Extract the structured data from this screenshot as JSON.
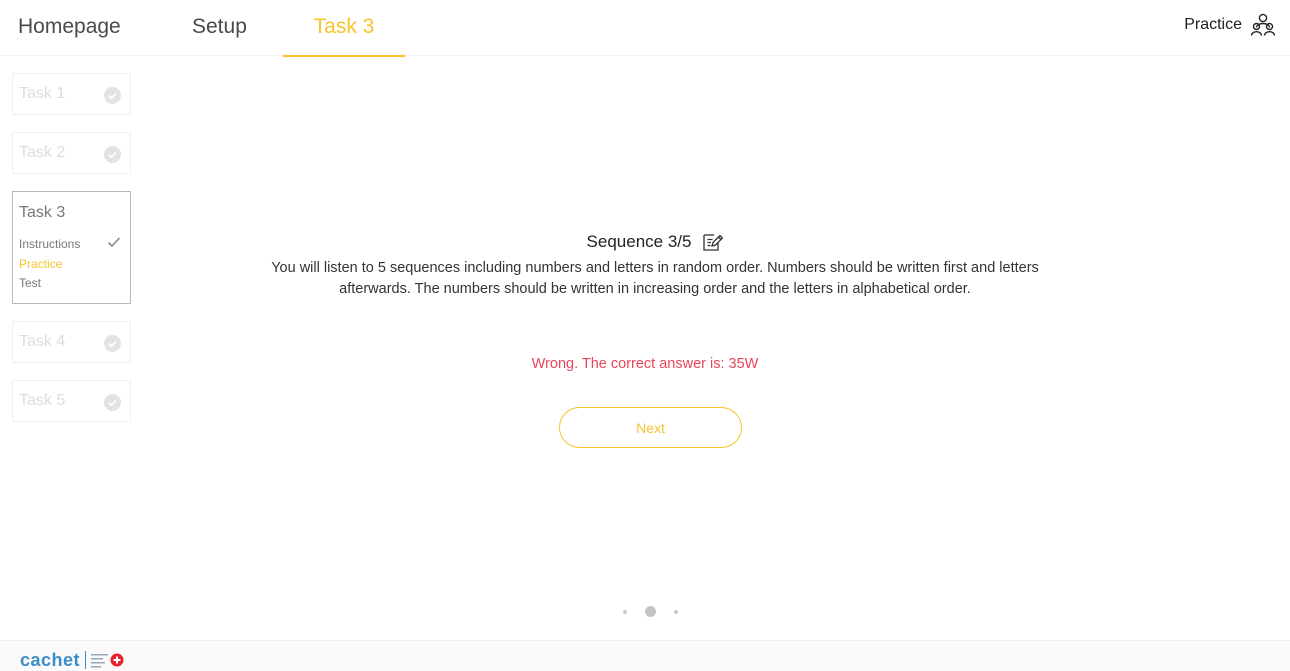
{
  "nav": {
    "tabs": [
      {
        "label": "Homepage"
      },
      {
        "label": "Setup"
      },
      {
        "label": "Task 3"
      }
    ],
    "active_color": "#f6c42b",
    "mode_label": "Practice",
    "mode_icon": "user-group-icon"
  },
  "sidebar": {
    "tasks": [
      {
        "label": "Task 1",
        "status": "completed"
      },
      {
        "label": "Task 2",
        "status": "completed"
      },
      {
        "label": "Task 3",
        "status": "current"
      },
      {
        "label": "Task 4",
        "status": "locked"
      },
      {
        "label": "Task 5",
        "status": "locked"
      }
    ],
    "current_steps": [
      {
        "label": "Instructions",
        "done": true
      },
      {
        "label": "Practice",
        "active": true
      },
      {
        "label": "Test"
      }
    ]
  },
  "main": {
    "sequence_title": "Sequence 3/5",
    "edit_icon": "edit-note-icon",
    "instructions_line1": "You will listen to 5 sequences including numbers and letters in random order. Numbers should be written first and letters",
    "instructions_line2": "afterwards. The numbers should be written in increasing order and the letters in alphabetical order.",
    "feedback": "Wrong. The correct answer is: 35W",
    "feedback_color": "#e9455a",
    "next_label": "Next"
  },
  "pager": {
    "count": 3,
    "active_index": 1
  },
  "footer": {
    "logo_text": "cachet"
  }
}
